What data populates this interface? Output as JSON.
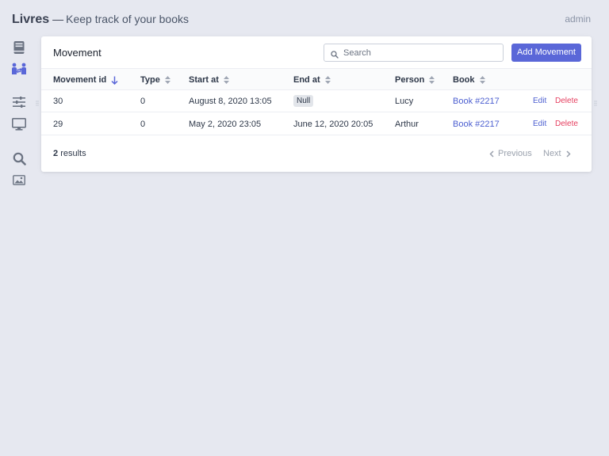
{
  "app": {
    "name": "Livres",
    "separator": "—",
    "tagline": "Keep track of your books",
    "user": "admin"
  },
  "sidebar": {
    "icons": [
      "book-icon",
      "people-exchange-icon",
      "sliders-icon",
      "monitor-icon",
      "search-icon",
      "image-icon"
    ],
    "active": "people-exchange-icon"
  },
  "panel": {
    "title": "Movement",
    "search_placeholder": "Search",
    "search_value": "",
    "add_button": "Add Movement"
  },
  "table": {
    "columns": [
      "Movement id",
      "Type",
      "Start at",
      "End at",
      "Person",
      "Book"
    ],
    "sorted_column": "Movement id",
    "rows": [
      {
        "id": "30",
        "type": "0",
        "start": "August 8, 2020 13:05",
        "end": "Null",
        "end_is_null": true,
        "person": "Lucy",
        "book": "Book #2217",
        "edit": "Edit",
        "delete": "Delete"
      },
      {
        "id": "29",
        "type": "0",
        "start": "May 2, 2020 23:05",
        "end": "June 12, 2020 20:05",
        "end_is_null": false,
        "person": "Arthur",
        "book": "Book #2217",
        "edit": "Edit",
        "delete": "Delete"
      }
    ]
  },
  "footer": {
    "count": "2",
    "count_label": "results",
    "previous": "Previous",
    "next": "Next"
  },
  "colors": {
    "accent": "#5a67d8",
    "link": "#4c5fd0",
    "danger": "#e53e5f",
    "background": "#e6e8f0"
  }
}
